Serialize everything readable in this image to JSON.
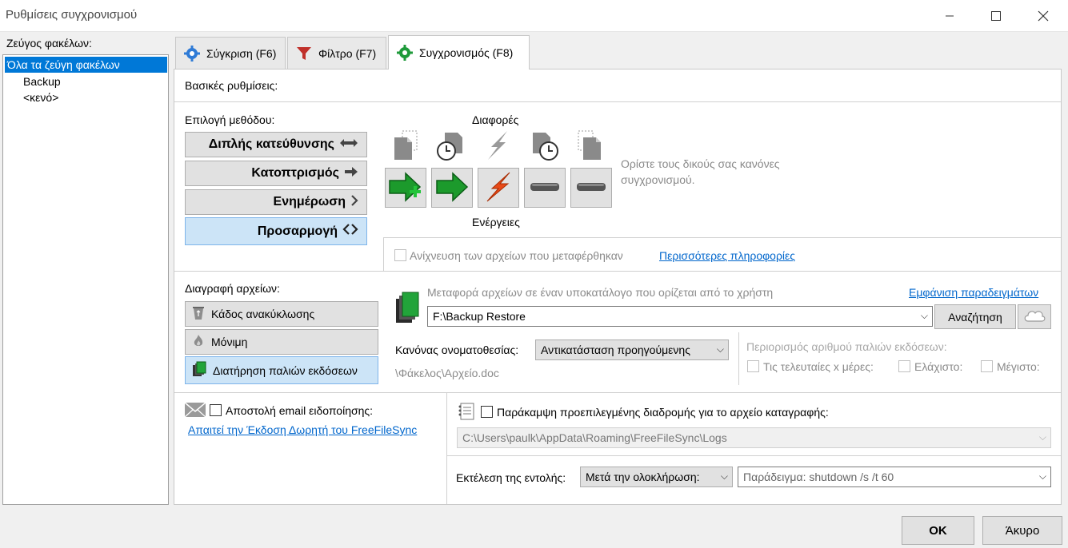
{
  "window": {
    "title": "Ρυθμίσεις συγχρονισμού",
    "minimize_icon": "minimize-icon",
    "maximize_icon": "maximize-icon",
    "close_icon": "close-icon"
  },
  "left": {
    "label": "Ζεύγος φακέλων:",
    "items": [
      {
        "label": "Όλα τα ζεύγη φακέλων",
        "selected": true
      },
      {
        "label": "Backup",
        "selected": false
      },
      {
        "label": "<κενό>",
        "selected": false
      }
    ]
  },
  "tabs": [
    {
      "label": "Σύγκριση (F6)",
      "icon": "gear-blue-icon",
      "active": false
    },
    {
      "label": "Φίλτρο (F7)",
      "icon": "funnel-icon",
      "active": false
    },
    {
      "label": "Συγχρονισμός (F8)",
      "icon": "gear-green-icon",
      "active": true
    }
  ],
  "sync": {
    "basic_settings": "Βασικές ρυθμίσεις:",
    "method_label": "Επιλογή μεθόδου:",
    "methods": [
      {
        "label": "Διπλής κατεύθυνσης",
        "symbol": "⟷",
        "active": false
      },
      {
        "label": "Κατοπτρισμός",
        "symbol": "➜",
        "active": false
      },
      {
        "label": "Ενημέρωση",
        "symbol": ">",
        "active": false
      },
      {
        "label": "Προσαρμογή",
        "symbol": "<>",
        "active": true
      }
    ],
    "differences_label": "Διαφορές",
    "actions_label": "Ενέργειες",
    "rules_hint": "Ορίστε τους δικούς σας κανόνες συγχρονισμού.",
    "detect_moved": "Ανίχνευση των αρχείων που μεταφέρθηκαν",
    "more_info": "Περισσότερες πληροφορίες",
    "delete_label": "Διαγραφή αρχείων:",
    "delete_options": [
      {
        "label": "Κάδος ανακύκλωσης",
        "icon": "recycle-bin-icon",
        "active": false
      },
      {
        "label": "Μόνιμη",
        "icon": "flame-icon",
        "active": false
      },
      {
        "label": "Διατήρηση παλιών εκδόσεων",
        "icon": "versions-icon",
        "active": true
      }
    ],
    "versioning_hint": "Μεταφορά αρχείων σε έναν υποκατάλογο που ορίζεται από το χρήστη",
    "show_examples": "Εμφάνιση παραδειγμάτων",
    "versioning_path": "F:\\Backup Restore",
    "browse": "Αναζήτηση",
    "naming_label": "Κανόνας ονοματοθεσίας:",
    "naming_value": "Αντικατάσταση προηγούμενης",
    "naming_example": "\\Φάκελος\\Αρχείο.doc",
    "limit_label": "Περιορισμός αριθμού παλιών εκδόσεων:",
    "limit_days": "Τις τελευταίες x μέρες:",
    "limit_min": "Ελάχιστο:",
    "limit_max": "Μέγιστο:",
    "email_label": "Αποστολή email ειδοποίησης:",
    "donation_link": "Απαιτεί την Έκδοση Δωρητή του FreeFileSync",
    "log_override": "Παράκαμψη προεπιλεγμένης διαδρομής για το αρχείο καταγραφής:",
    "log_path": "C:\\Users\\paulk\\AppData\\Roaming\\FreeFileSync\\Logs",
    "run_label": "Εκτέλεση της εντολής:",
    "run_when": "Μετά την ολοκλήρωση:",
    "run_placeholder": "Παράδειγμα: shutdown /s /t 60"
  },
  "footer": {
    "ok": "OK",
    "cancel": "Άκυρο"
  },
  "colors": {
    "selection": "#0078d7",
    "active_button": "#cce4f7",
    "link": "#0066cc"
  }
}
